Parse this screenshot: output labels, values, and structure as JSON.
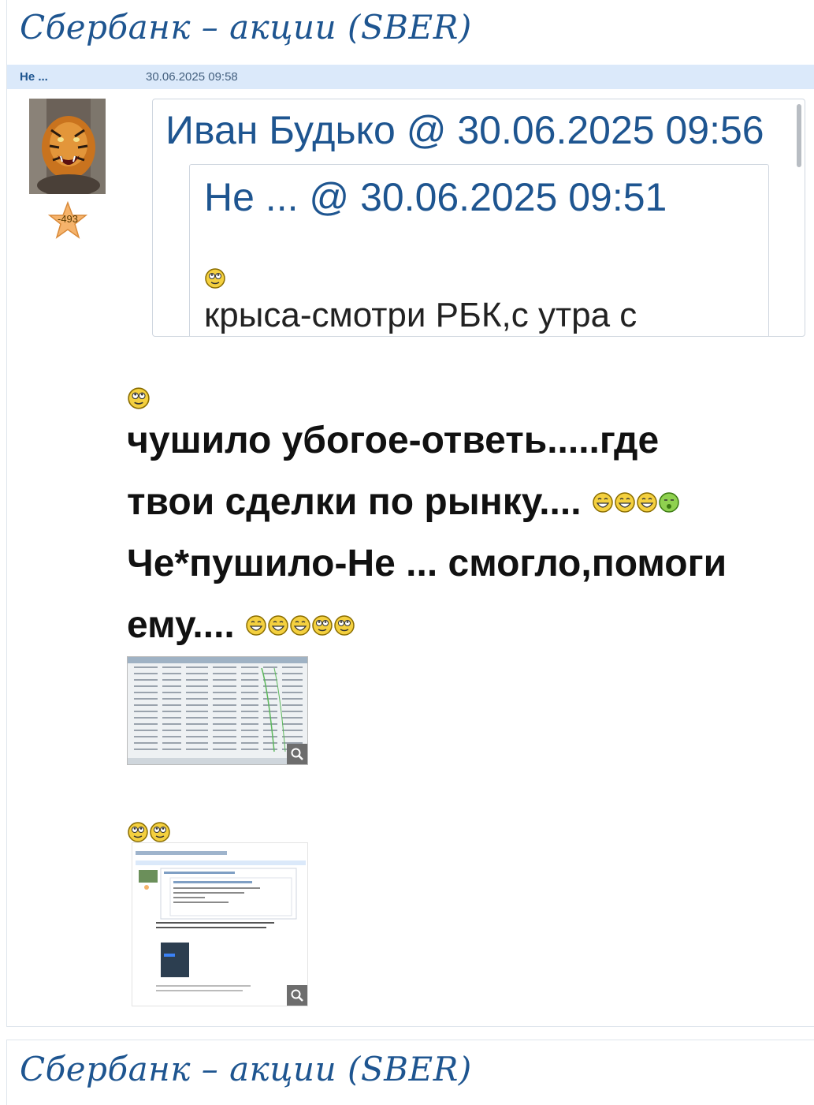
{
  "topic": {
    "title": "Сбербанк – акции (SBER)"
  },
  "post": {
    "author": "Не ...",
    "timestamp": "30.06.2025 09:58",
    "avatar": "tiger-avatar-icon",
    "rating": "-493",
    "quote": {
      "author": "Иван Будько",
      "at": "@",
      "timestamp": "30.06.2025 09:56",
      "nested": {
        "author": "Не ...",
        "at": "@",
        "timestamp": "30.06.2025 09:51",
        "text": "крыса-смотри РБК,с утра с"
      }
    },
    "message_lines": [
      "чушило убогое-ответь.....где",
      "твои сделки по рынку....",
      "Че*пушило-Не ... смогло,помоги",
      "ему...."
    ],
    "attachments": [
      "trades-table-screenshot",
      "forum-post-screenshot"
    ]
  },
  "next_topic": {
    "title": "Сбербанк – акции (SBER)"
  },
  "colors": {
    "link": "#1e5590",
    "meta_bar": "#dbe9fa",
    "smiley": "#f4d03f"
  }
}
